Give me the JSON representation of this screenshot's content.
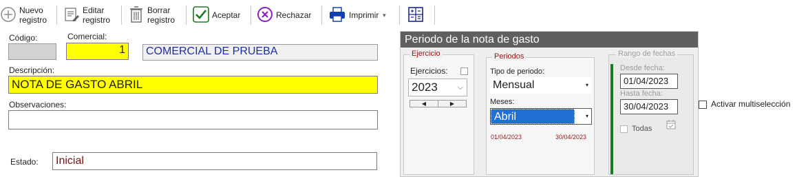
{
  "toolbar": {
    "nuevo": "Nuevo\nregistro",
    "editar": "Editar\nregistro",
    "borrar": "Borrar\nregistro",
    "aceptar": "Aceptar",
    "rechazar": "Rechazar",
    "imprimir": "Imprimir"
  },
  "form": {
    "codigo_label": "Código:",
    "codigo_value": "",
    "comercial_label": "Comercial:",
    "comercial_value": "1",
    "comercial_name": "COMERCIAL DE PRUEBA",
    "descripcion_label": "Descripción:",
    "descripcion_value": "NOTA DE GASTO ABRIL",
    "observaciones_label": "Observaciones:",
    "observaciones_value": "",
    "estado_label": "Estado:",
    "estado_value": "Inicial"
  },
  "periodo": {
    "title": "Periodo de la nota de gasto",
    "ejercicio_group": "Ejercicio",
    "ejercicios_label": "Ejercicios:",
    "year": "2023",
    "periodos_group": "Periodos",
    "tipo_label": "Tipo de periodo:",
    "tipo_value": "Mensual",
    "meses_label": "Meses:",
    "mes_value": "Abril",
    "range_start": "01/04/2023",
    "range_end": "30/04/2023",
    "rango_group": "Rango de fechas",
    "desde_label": "Desde fecha:",
    "desde_value": "01/04/2023",
    "hasta_label": "Hasta fecha:",
    "hasta_value": "30/04/2023",
    "todas_label": "Todas"
  },
  "multiseleccion_label": "Activar multiselección",
  "colors": {
    "yellow_field": "#ffff00",
    "blue_text": "#1c2fa8",
    "dark_red_text": "#7a1010",
    "panel_title": "#5f5f5f",
    "green_bar": "#1e7a1e",
    "selection_blue": "#1f6fd6"
  }
}
